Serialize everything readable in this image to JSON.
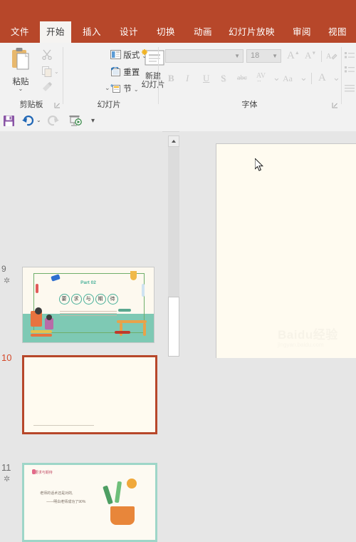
{
  "app": {
    "accent": "#b7472a",
    "canvas_bg": "#fffbf0"
  },
  "tabs": [
    {
      "label": "文件",
      "name": "tab-file",
      "active": false
    },
    {
      "label": "开始",
      "name": "tab-home",
      "active": true
    },
    {
      "label": "插入",
      "name": "tab-insert",
      "active": false
    },
    {
      "label": "设计",
      "name": "tab-design",
      "active": false
    },
    {
      "label": "切换",
      "name": "tab-transitions",
      "active": false
    },
    {
      "label": "动画",
      "name": "tab-animations",
      "active": false
    },
    {
      "label": "幻灯片放映",
      "name": "tab-slideshow",
      "active": false
    },
    {
      "label": "审阅",
      "name": "tab-review",
      "active": false
    },
    {
      "label": "视图",
      "name": "tab-view",
      "active": false
    }
  ],
  "ribbon": {
    "clipboard": {
      "group_label": "剪贴板",
      "paste_label": "粘贴",
      "cut_icon": "scissors-icon",
      "copy_icon": "copy-icon",
      "format_painter_icon": "format-painter-icon",
      "dialog_launcher": "dialog-launcher-icon"
    },
    "slides": {
      "group_label": "幻灯片",
      "new_slide_line1": "新建",
      "new_slide_line2": "幻灯片",
      "layout_label": "版式",
      "reset_label": "重置",
      "section_label": "节"
    },
    "font": {
      "group_label": "字体",
      "font_name_value": "",
      "font_name_placeholder": "",
      "font_size_value": "18",
      "grow_font": "A",
      "shrink_font": "A",
      "clear_format_icon": "clear-formatting-icon",
      "bold": "B",
      "italic": "I",
      "underline": "U",
      "shadow": "S",
      "strikethrough": "abc",
      "char_spacing": "AV",
      "change_case": "Aa",
      "font_color": "A",
      "dialog_launcher": "dialog-launcher-icon"
    },
    "paragraph": {
      "bullets_icon": "bullet-list-icon",
      "numbering_icon": "numbered-list-icon",
      "align_icon": "align-left-icon"
    }
  },
  "quick_access": {
    "save": "save-icon",
    "undo": "undo-icon",
    "redo": "redo-icon",
    "slideshow": "start-slideshow-icon",
    "customize": "customize-qat-icon"
  },
  "slide_pane": {
    "slides": [
      {
        "number": "9",
        "name": "slide-thumbnail-9",
        "selected": false,
        "has_animation": true,
        "title_part": "Part 02",
        "title_chars": [
          "要",
          "求",
          "与",
          "期",
          "待"
        ]
      },
      {
        "number": "10",
        "name": "slide-thumbnail-10",
        "selected": true,
        "has_animation": false,
        "title_part": "",
        "title_chars": []
      },
      {
        "number": "11",
        "name": "slide-thumbnail-11",
        "selected": false,
        "has_animation": true,
        "heading": "要求与期待",
        "body_line1": "老师的话术还是对的,",
        "body_line2": "——明白老师成功了90%"
      }
    ]
  },
  "scrollbar": {
    "up_arrow": "scroll-up-icon",
    "thumb": "scrollbar-thumb"
  },
  "watermark": {
    "line1": "Baidu经验",
    "line2": "jingyan.baidu.com"
  }
}
